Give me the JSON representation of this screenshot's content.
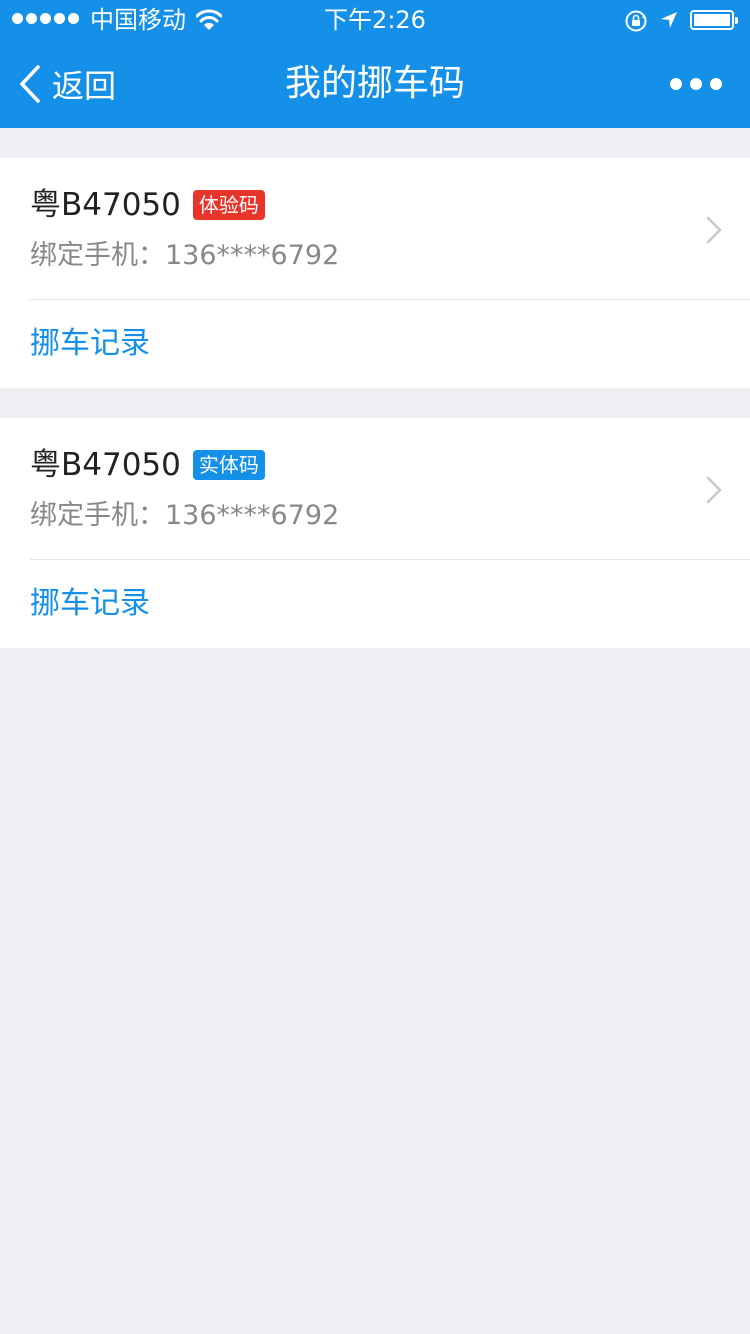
{
  "status_bar": {
    "carrier": "中国移动",
    "time": "下午2:26",
    "icons": [
      "signal-dots-icon",
      "wifi-icon",
      "rotation-lock-icon",
      "location-arrow-icon",
      "battery-icon"
    ]
  },
  "nav": {
    "back_label": "返回",
    "title": "我的挪车码",
    "icons": [
      "back-chevron-icon",
      "more-dots-icon"
    ]
  },
  "colors": {
    "nav_bg": "#1590e8",
    "page_bg": "#efeff4",
    "trial_badge": "#e8352c",
    "physical_badge": "#1590e8",
    "link": "#1590e8"
  },
  "cards": [
    {
      "plate": "粤B47050",
      "badge": "体验码",
      "phone_label": "绑定手机：",
      "phone": "136****6792",
      "record_label": "挪车记录"
    },
    {
      "plate": "粤B47050",
      "badge": "实体码",
      "phone_label": "绑定手机：",
      "phone": "136****6792",
      "record_label": "挪车记录"
    }
  ]
}
